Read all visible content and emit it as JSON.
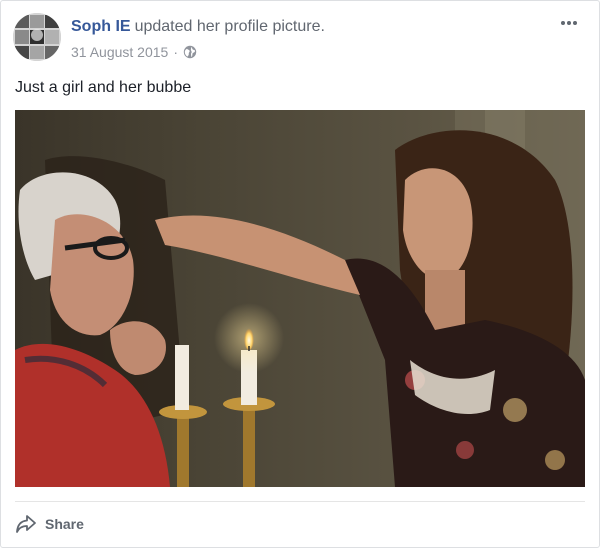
{
  "post": {
    "author_name": "Soph IE",
    "action_text": "updated her profile picture.",
    "timestamp": "31 August 2015",
    "separator": "·",
    "audience_icon": "globe-icon",
    "more_icon": "more-options-icon",
    "caption": "Just a girl and her bubbe"
  },
  "actions": {
    "share_label": "Share",
    "share_icon": "share-arrow-icon"
  },
  "colors": {
    "author_link": "#365899",
    "secondary_text": "#90949c",
    "card_border": "#dddfe2"
  }
}
